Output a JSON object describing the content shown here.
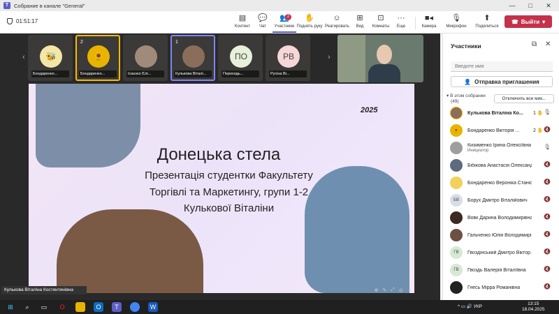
{
  "window": {
    "title": "Собрание в канале \"General\"",
    "minimize": "—",
    "maximize": "□",
    "close": "✕"
  },
  "toolbar": {
    "timer": "01:51:17",
    "content": "Контент",
    "chat": "Чат",
    "participants": "Участники",
    "participants_badge": "2",
    "raise_hand": "Поднять руку",
    "react": "Реагировать",
    "view": "Вид",
    "rooms": "Комнаты",
    "more": "Еще",
    "camera": "Камера",
    "mic": "Микрофон",
    "share": "Поделиться",
    "leave": "Выйти"
  },
  "thumbnails": [
    {
      "name": "Бондаренко...",
      "count": ""
    },
    {
      "name": "Бондаренко...",
      "count": "2"
    },
    {
      "name": "Ісаєнко Єлі...",
      "count": ""
    },
    {
      "name": "Кулькова Віталі...",
      "count": "1"
    },
    {
      "name": "Переходь...",
      "count": "",
      "initials": "ПО"
    },
    {
      "name": "Русіна Ві...",
      "count": "",
      "initials": "РВ"
    }
  ],
  "slide": {
    "year": "2025",
    "title": "Донецька стела",
    "line1": "Презентація студентки Факультету",
    "line2": "Торгівлі та Маркетингу, групи 1-2",
    "line3": "Кулькової Віталіни"
  },
  "presenter": "Кулькова Віталіна Костянтинівна",
  "panel": {
    "title": "Участники",
    "search_placeholder": "Введите имя",
    "invite": "Отправка приглашения",
    "section": "В этом собрании",
    "section_count": "(49)",
    "mute_all": "Отключить все мик...",
    "people": [
      {
        "name": "Кулькова Віталіна Ко...",
        "hand": "1",
        "initials": "",
        "color": "#8a6d5a",
        "bold": true
      },
      {
        "name": "Бондаренко Вікторія ...",
        "hand": "2",
        "initials": "",
        "color": "#e8b400"
      },
      {
        "name": "Кизименко Ірина Олексіївна",
        "sub": "Инициатор",
        "initials": "",
        "color": "#9e9e9e"
      },
      {
        "name": "Бібікова Анастасія Олександ...",
        "initials": "",
        "color": "#5d6a80"
      },
      {
        "name": "Бондаренко Вероніка Станіс...",
        "initials": "",
        "color": "#f2d15a"
      },
      {
        "name": "Борух Дмитро Віталійович",
        "initials": "БВ",
        "color": "#d9dde8"
      },
      {
        "name": "Вовк Дарина Володимирівна",
        "initials": "",
        "color": "#3b2a22"
      },
      {
        "name": "Гальченко Юлія Володимирі...",
        "initials": "",
        "color": "#6b5043"
      },
      {
        "name": "Гвоздінський Дмитро Віктор...",
        "initials": "ГВ",
        "color": "#d6e9d3"
      },
      {
        "name": "Гвоздь Валерія Віталіївна",
        "initials": "ГВ",
        "color": "#d6e9d3"
      },
      {
        "name": "Гнесь Мірра Романівна",
        "initials": "",
        "color": "#222222"
      }
    ]
  },
  "taskbar": {
    "time": "13:15",
    "date": "18.04.2025",
    "lang": "УКР"
  }
}
